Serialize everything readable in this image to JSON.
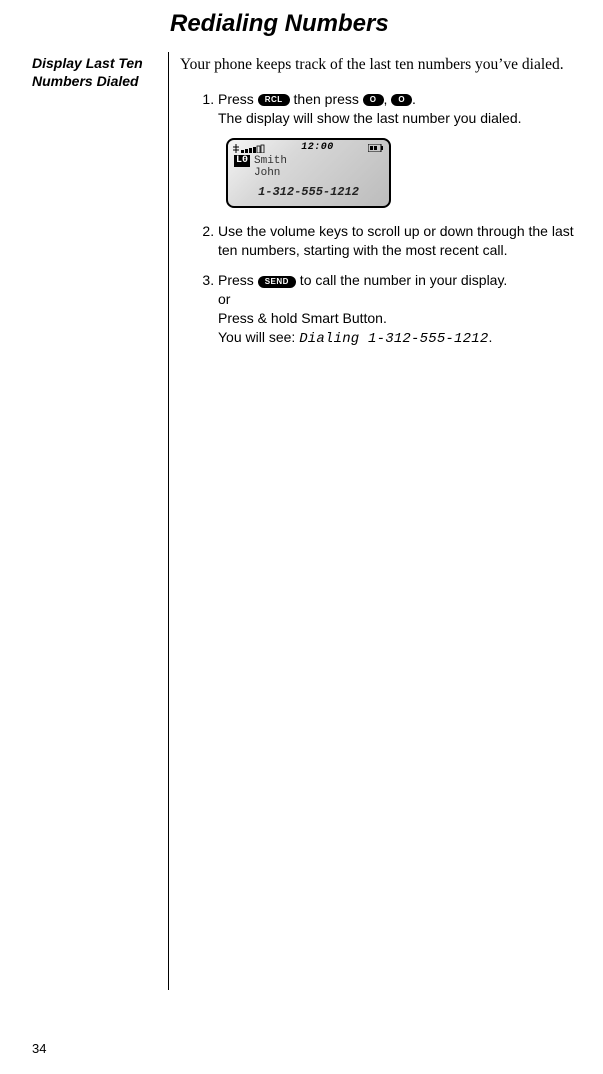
{
  "title": "Redialing Numbers",
  "sidebar_heading": "Display Last Ten Numbers Dialed",
  "intro": "Your phone keeps track of the last ten numbers you’ve dialed.",
  "keys": {
    "rcl": "RCL",
    "zero": "O",
    "send": "SEND"
  },
  "steps": {
    "s1_a": "Press ",
    "s1_b": " then press ",
    "s1_c": ", ",
    "s1_d": ".",
    "s1_line2": "The display will show the last number you dialed.",
    "s2": "Use the volume keys to scroll up or down through the last ten numbers, starting with the most recent call.",
    "s3_a": "Press ",
    "s3_b": " to call the number in your display.",
    "s3_or": "or",
    "s3_line2": "Press & hold Smart Button.",
    "s3_line3a": "You will see: ",
    "s3_line3b": "Dialing 1-312-555-1212",
    "s3_line3c": "."
  },
  "display": {
    "time": "12:00",
    "badge": "L0",
    "name_line1": "Smith",
    "name_line2": "John",
    "number": "1-312-555-1212"
  },
  "page_number": "34"
}
